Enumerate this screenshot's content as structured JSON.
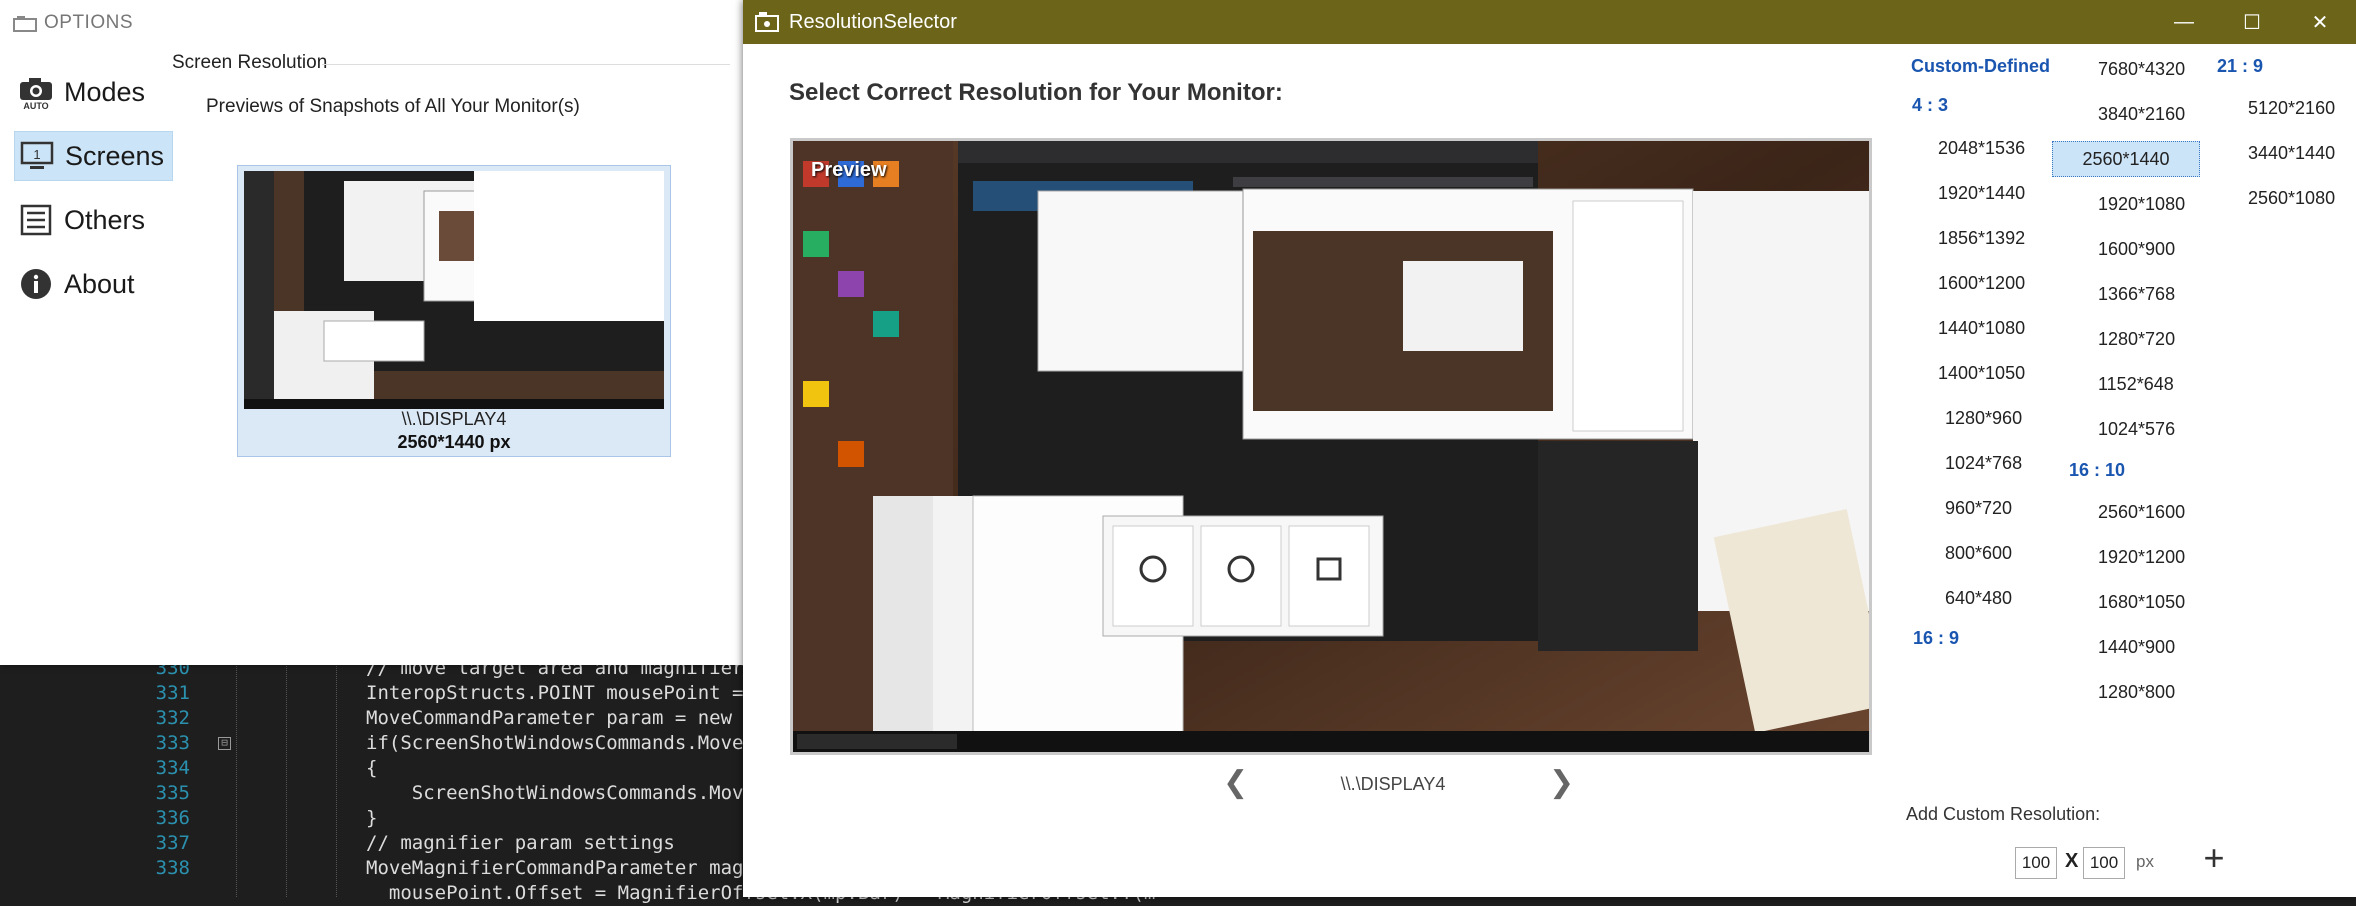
{
  "editor": {
    "lines": [
      {
        "no": "330",
        "text": "// move target area and magnifier"
      },
      {
        "no": "331",
        "text": "InteropStructs.POINT mousePoint = new"
      },
      {
        "no": "332",
        "text": "MoveCommandParameter param = new Mo"
      },
      {
        "no": "333",
        "text": "if(ScreenShotWindowsCommands.MoveC"
      },
      {
        "no": "334",
        "text": "{"
      },
      {
        "no": "335",
        "text": "    ScreenShotWindowsCommands.MoveC"
      },
      {
        "no": "336",
        "text": "}"
      },
      {
        "no": "337",
        "text": "// magnifier param settings"
      },
      {
        "no": "338",
        "text": "MoveMagnifierCommandParameter magPa"
      },
      {
        "no": "",
        "text": "  mousePoint.Offset = MagnifierOffset.X(mp.Bar) = MagnifierOffset.Y(m"
      }
    ],
    "fold_symbol": "⊟"
  },
  "options": {
    "title": "OPTIONS",
    "nav": [
      {
        "label": "Modes",
        "icon": "camera-auto-icon"
      },
      {
        "label": "Screens",
        "icon": "monitor-icon",
        "selected": true
      },
      {
        "label": "Others",
        "icon": "list-icon"
      },
      {
        "label": "About",
        "icon": "info-icon"
      }
    ],
    "section_title": "Screen Resolution",
    "subtitle": "Previews of Snapshots of All Your Monitor(s)",
    "display": {
      "name": "\\\\.\\DISPLAY4",
      "resolution": "2560*1440 px"
    }
  },
  "selector": {
    "title": "ResolutionSelector",
    "window_buttons": {
      "minimize": "—",
      "maximize": "☐",
      "close": "✕"
    },
    "heading": "Select Correct Resolution for Your Monitor:",
    "preview_label": "Preview",
    "display_name": "\\\\.\\DISPLAY4",
    "prev": "❮",
    "next": "❯",
    "custom_defined": "Custom-Defined",
    "ratio_4_3": "4 : 3",
    "ratio_16_9": "16 : 9",
    "ratio_16_10": "16 : 10",
    "ratio_21_9": "21 : 9",
    "list_4_3": [
      "2048*1536",
      "1920*1440",
      "1856*1392",
      "1600*1200",
      "1440*1080",
      "1400*1050",
      "1280*960",
      "1024*768",
      "960*720",
      "800*600",
      "640*480"
    ],
    "list_16_9": [
      "7680*4320",
      "3840*2160",
      "2560*1440",
      "1920*1080",
      "1600*900",
      "1366*768",
      "1280*720",
      "1152*648",
      "1024*576"
    ],
    "list_16_10": [
      "2560*1600",
      "1920*1200",
      "1680*1050",
      "1440*900",
      "1280*800"
    ],
    "list_21_9": [
      "5120*2160",
      "3440*1440",
      "2560*1080"
    ],
    "selected": "2560*1440",
    "add_label": "Add Custom Resolution:",
    "width_value": "100",
    "height_value": "100",
    "x_label": "X",
    "px_label": "px",
    "plus": "+"
  },
  "colors": {
    "titlebar": "#6b6419",
    "accent_blue": "#1a56b0",
    "selection": "#cce4f7"
  }
}
